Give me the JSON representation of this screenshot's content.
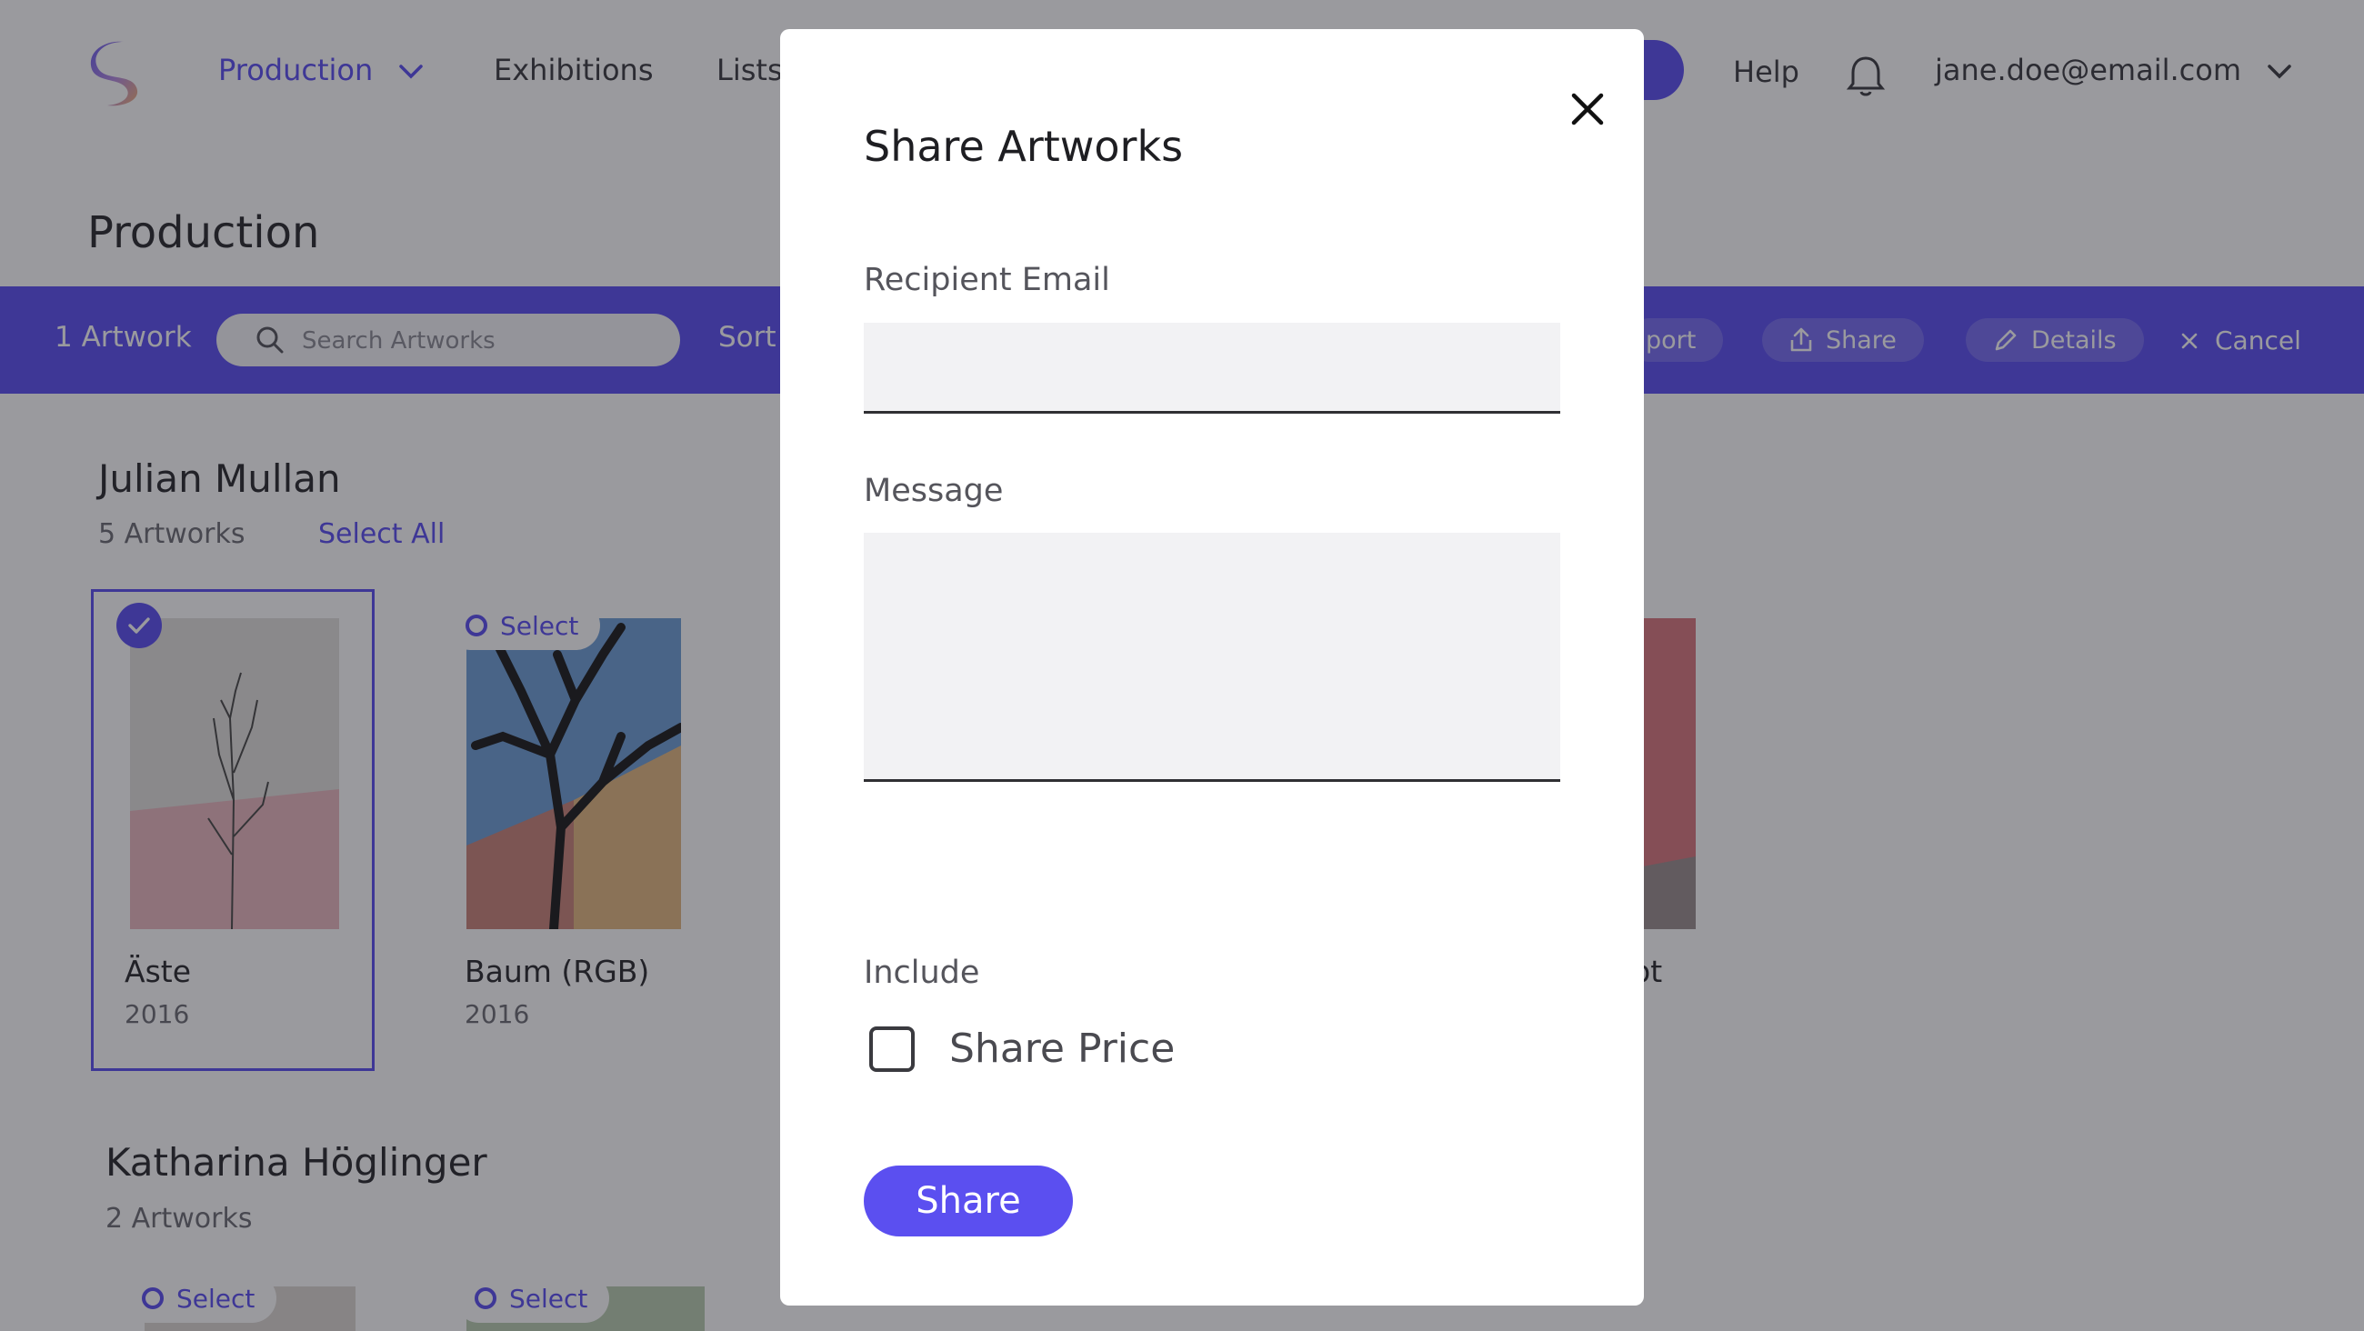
{
  "nav": {
    "production": "Production",
    "exhibitions": "Exhibitions",
    "lists": "Lists",
    "help": "Help",
    "user_email": "jane.doe@email.com"
  },
  "page": {
    "title": "Production"
  },
  "toolbar": {
    "count": "1 Artwork",
    "search_placeholder": "Search Artworks",
    "sort": "Sort",
    "export_partial": "port",
    "share": "Share",
    "details": "Details",
    "cancel": "Cancel"
  },
  "groups": [
    {
      "artist": "Julian Mullan",
      "count": "5 Artworks",
      "select_all": "Select All",
      "artworks": [
        {
          "title": "Äste",
          "year": "2016",
          "selected": true
        },
        {
          "title": "Baum (RGB)",
          "year": "2016",
          "select_label": "Select"
        },
        {
          "title_partial": "ot"
        }
      ]
    },
    {
      "artist": "Katharina Höglinger",
      "count": "2 Artworks",
      "artworks": [
        {
          "select_label": "Select"
        },
        {
          "select_label": "Select"
        }
      ]
    }
  ],
  "modal": {
    "title": "Share Artworks",
    "recipient_label": "Recipient Email",
    "recipient_value": "",
    "message_label": "Message",
    "message_value": "",
    "include_label": "Include",
    "share_price_label": "Share Price",
    "share_price_checked": false,
    "submit_label": "Share"
  },
  "colors": {
    "accent": "#5b4ff0",
    "overlay": "rgba(24,24,34,0.44)",
    "input_bg": "#f2f2f4"
  }
}
